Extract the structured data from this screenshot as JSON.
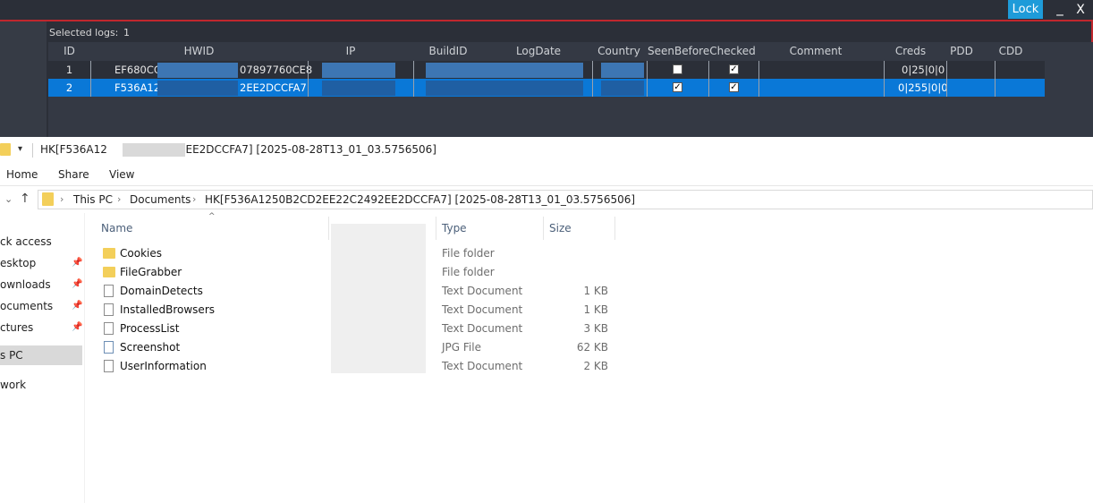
{
  "window": {
    "lock_label": "Lock",
    "minimize_label": "_",
    "close_label": "X"
  },
  "logs": {
    "selected_label": "Selected logs:",
    "selected_count": "1",
    "columns": [
      "ID",
      "HWID",
      "IP",
      "BuildID",
      "LogDate",
      "Country",
      "SeenBefore",
      "Checked",
      "Comment",
      "Creds",
      "PDD",
      "CDD"
    ],
    "rows": [
      {
        "id": "1",
        "hwid_start": "EF680CC",
        "hwid_end": "07897760CE8",
        "seen_before": false,
        "checked": true,
        "creds": "0|25|0|0",
        "selected": false
      },
      {
        "id": "2",
        "hwid_start": "F536A12",
        "hwid_end": "2EE2DCCFA7",
        "seen_before": true,
        "checked": true,
        "creds": "0|255|0|0",
        "selected": true
      }
    ]
  },
  "explorer": {
    "title_start": "HK[F536A12",
    "title_end": "2EE2DCCFA7] [2025-08-28T13_01_03.5756506]",
    "ribbon_tabs": [
      "Home",
      "Share",
      "View"
    ],
    "breadcrumb": [
      "This PC",
      "Documents",
      "HK[F536A1250B2CD2EE22C2492EE2DCCFA7] [2025-08-28T13_01_03.5756506]"
    ],
    "nav_items": [
      "ck access",
      "esktop",
      "ownloads",
      "ocuments",
      "ctures",
      "s PC",
      "work"
    ],
    "columns": {
      "name": "Name",
      "type": "Type",
      "size": "Size"
    },
    "files": [
      {
        "name": "Cookies",
        "type": "File folder",
        "size": "",
        "icon": "folder-icon"
      },
      {
        "name": "FileGrabber",
        "type": "File folder",
        "size": "",
        "icon": "folder-icon"
      },
      {
        "name": "DomainDetects",
        "type": "Text Document",
        "size": "1 KB",
        "icon": "text-file-icon"
      },
      {
        "name": "InstalledBrowsers",
        "type": "Text Document",
        "size": "1 KB",
        "icon": "text-file-icon"
      },
      {
        "name": "ProcessList",
        "type": "Text Document",
        "size": "3 KB",
        "icon": "text-file-icon"
      },
      {
        "name": "Screenshot",
        "type": "JPG File",
        "size": "62 KB",
        "icon": "jpg-file-icon"
      },
      {
        "name": "UserInformation",
        "type": "Text Document",
        "size": "2 KB",
        "icon": "text-file-icon"
      }
    ]
  },
  "colors": {
    "accent": "#1e9bd9",
    "selection": "#0a78d7",
    "frame": "#c0272d",
    "dark_bg": "#2b2f38"
  }
}
